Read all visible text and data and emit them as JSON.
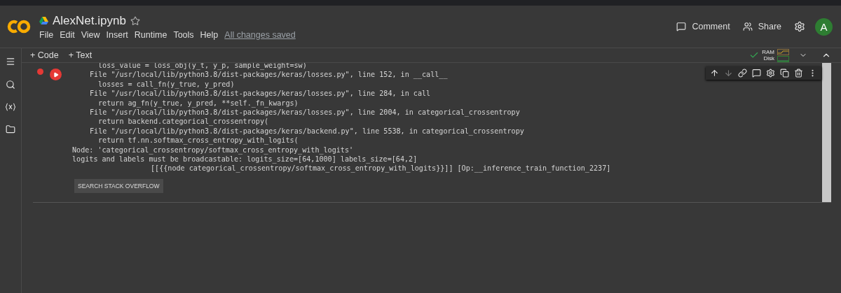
{
  "notebook": {
    "title": "AlexNet.ipynb",
    "starred": false
  },
  "menu": [
    "File",
    "Edit",
    "View",
    "Insert",
    "Runtime",
    "Tools",
    "Help"
  ],
  "save_status": "All changes saved",
  "header_actions": [
    {
      "kind": "comment",
      "label": "Comment"
    },
    {
      "kind": "share",
      "label": "Share"
    }
  ],
  "account": {
    "initial": "A"
  },
  "toolbar": {
    "add_buttons": [
      "+ Code",
      "+ Text"
    ],
    "resources": {
      "connected": true,
      "ram_label": "RAM",
      "disk_label": "Disk"
    }
  },
  "cell": {
    "error": true,
    "output_lines": [
      {
        "kind": "code",
        "text": "loss_value = loss_obj(y_t, y_p, sample_weight=sw)"
      },
      {
        "kind": "frame",
        "text": "File \"/usr/local/lib/python3.8/dist-packages/keras/losses.py\", line 152, in __call__"
      },
      {
        "kind": "code",
        "text": "losses = call_fn(y_true, y_pred)"
      },
      {
        "kind": "frame",
        "text": "File \"/usr/local/lib/python3.8/dist-packages/keras/losses.py\", line 284, in call"
      },
      {
        "kind": "code",
        "text": "return ag_fn(y_true, y_pred, **self._fn_kwargs)"
      },
      {
        "kind": "frame",
        "text": "File \"/usr/local/lib/python3.8/dist-packages/keras/losses.py\", line 2004, in categorical_crossentropy"
      },
      {
        "kind": "code",
        "text": "return backend.categorical_crossentropy("
      },
      {
        "kind": "frame",
        "text": "File \"/usr/local/lib/python3.8/dist-packages/keras/backend.py\", line 5538, in categorical_crossentropy"
      },
      {
        "kind": "code",
        "text": "return tf.nn.softmax_cross_entropy_with_logits("
      },
      {
        "kind": "message",
        "text": "Node: 'categorical_crossentropy/softmax_cross_entropy_with_logits'"
      },
      {
        "kind": "message",
        "text": "logits and labels must be broadcastable: logits_size=[64,1000] labels_size=[64,2]"
      },
      {
        "kind": "op",
        "text": "[[{{node categorical_crossentropy/softmax_cross_entropy_with_logits}}]] [Op:__inference_train_function_2237]"
      }
    ],
    "search_button": "SEARCH STACK OVERFLOW"
  }
}
